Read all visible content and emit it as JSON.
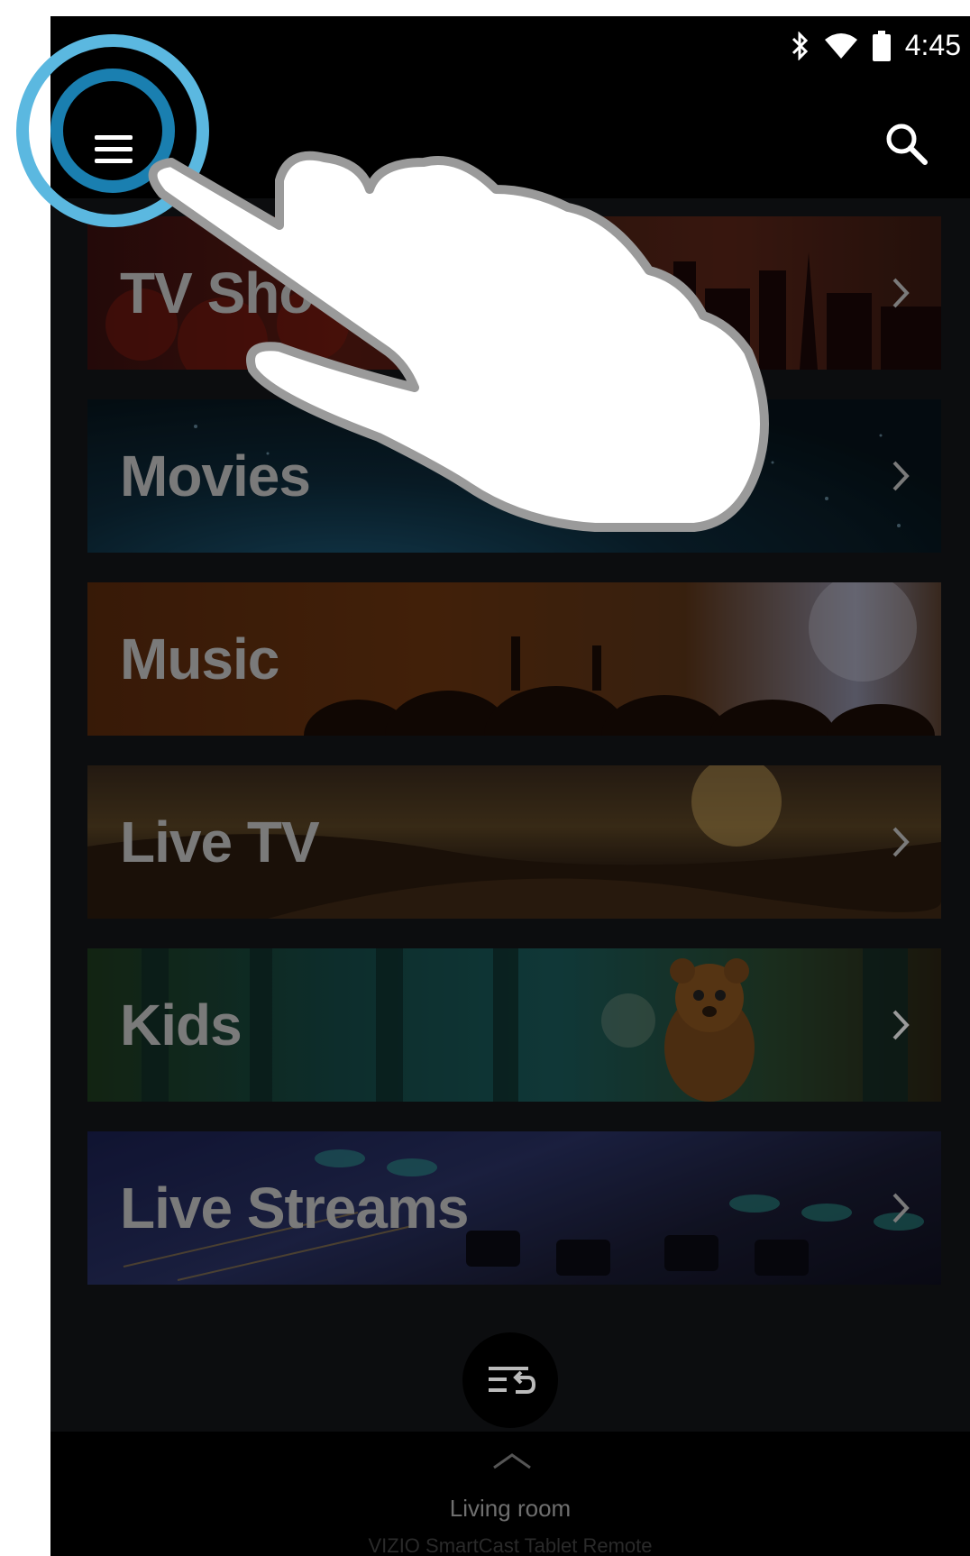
{
  "status_bar": {
    "time": "4:45",
    "icons": [
      "bluetooth-icon",
      "wifi-icon",
      "battery-icon"
    ]
  },
  "toolbar": {
    "menu_icon": "hamburger-menu-icon",
    "search_icon": "search-icon"
  },
  "categories": [
    {
      "label": "TV Shows",
      "visible_label": "TV Sho"
    },
    {
      "label": "Movies",
      "visible_label": "Movies"
    },
    {
      "label": "Music",
      "visible_label": "Music"
    },
    {
      "label": "Live TV",
      "visible_label": "Live TV"
    },
    {
      "label": "Kids",
      "visible_label": "Kids"
    },
    {
      "label": "Live Streams",
      "visible_label": "Live Streams"
    }
  ],
  "bottom": {
    "room": "Living room",
    "app_name": "VIZIO SmartCast Tablet Remote"
  },
  "colors": {
    "highlight_ring": "#5bb8e0",
    "highlight_ring_inner": "#1a7fb0",
    "background": "#0c0d0f",
    "tile_text": "#7a7a7a"
  }
}
